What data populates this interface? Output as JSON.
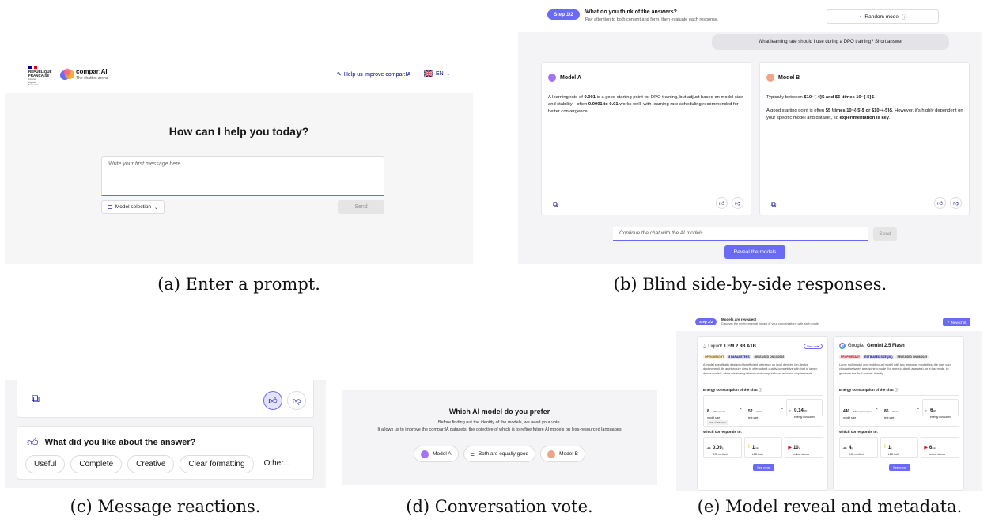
{
  "captions": {
    "a": "(a) Enter a prompt.",
    "b": "(b) Blind side-by-side responses.",
    "c": "(c) Message reactions.",
    "d": "(d) Conversation vote.",
    "e": "(e) Model reveal and metadata."
  },
  "panel_a": {
    "gov_logo_text": "RÉPUBLIQUE FRANÇAISE",
    "gov_motto": "Liberté Égalité Fraternité",
    "app_name": "compar:AI",
    "app_tagline": "The chatbot arena",
    "help_link": "Help us improve compar:IA",
    "language": "EN",
    "heading": "How can I help you today?",
    "input_placeholder": "Write your first message here",
    "model_selection_label": "Model selection",
    "send_label": "Send"
  },
  "panel_b": {
    "step_badge": "Step 1/2",
    "step_title": "What do you think of the answers?",
    "step_subtitle": "Pay attention to both content and form, then evaluate each response.",
    "mode_label": "Random mode",
    "user_question": "What learning rate should I use during a DPO training? Short answer",
    "model_a": {
      "name": "Model A",
      "text_1": "A learning rate of ",
      "text_1_bold": "0.001",
      "text_2": " is a good starting point for DPO training, but adjust based on model size and stability—often ",
      "text_2_bold": "0.0001 to 0.01",
      "text_3": " works well, with learning rate scheduling recommended for better convergence."
    },
    "model_b": {
      "name": "Model B",
      "p1_prefix": "Typically between ",
      "p1_bold": "$10~{-4}$ and $5 \\times 10~{-5}$",
      "p1_suffix": ".",
      "p2_prefix": "A good starting point is often ",
      "p2_bold": "$5 \\times 10~{-5}$ or $10~{-5}$",
      "p2_mid": ". However, it's highly dependent on your specific model and dataset, so ",
      "p2_bold2": "experimentation is key",
      "p2_suffix": "."
    },
    "continue_placeholder": "Continue the chat with the AI models",
    "send_label": "Send",
    "reveal_label": "Reveal the models"
  },
  "panel_c": {
    "question": "What did you like about the answer?",
    "tags": [
      "Useful",
      "Complete",
      "Creative",
      "Clear formatting",
      "Other..."
    ]
  },
  "panel_d": {
    "title": "Which AI model do you prefer",
    "line1": "Before finding out the identity of the models, we need your vote.",
    "line2": "It allows us to improve the compar:IA datasets, the objective of which is to refine future AI models on less-resourced languages",
    "option_a": "Model A",
    "option_equal": "Both are equally good",
    "option_b": "Model B"
  },
  "panel_e": {
    "step_badge": "Step 2/2",
    "title": "Models are revealed!",
    "subtitle": "Discover the environmental impact of your conversations with each model",
    "new_chat": "New chat",
    "left": {
      "provider": "Liquid/",
      "model": "LFM 2 8B A1B",
      "your_vote": "Your vote",
      "badges": [
        "OPEN-WEIGHT",
        "8 PARAMETERS",
        "RELEASED ON 10/2025"
      ],
      "description": "A model specifically designed for efficient inference on local devices (on-device deployment). Its architecture aims to offer output quality competitive with that of larger, dense models, while minimizing latency and computational resource requirements.",
      "energy_title": "Energy consumption of the chat",
      "params_value": "8",
      "params_unit": "billion params",
      "params_label": "model size",
      "tokens_value": "52",
      "tokens_unit": "tokens",
      "tokens_label": "text size",
      "energy_value": "0.14",
      "energy_unit": "Wh",
      "energy_label": "energy consumed",
      "arch_tag": "MoE architecture",
      "corresponds": "Which corresponds to:",
      "co2_value": "0.09",
      "co2_unit": "g",
      "co2_label": "CO₂ emitted",
      "led_value": "1",
      "led_unit": "min",
      "led_label": "LED bulb",
      "video_value": "10",
      "video_unit": "s",
      "video_label": "online videos",
      "see_more": "See more"
    },
    "right": {
      "provider": "Google/",
      "model": "Gemini 2.5 Flash",
      "badges": [
        "PROPRIETARY",
        "ESTIMATED SIZE (XL)",
        "RELEASED ON 06/2025"
      ],
      "description": "Large multimodal and multilingual model with two response modalities: the user can choose between a reasoning mode (for more in-depth answers), or a fast mode, to generate the final answer directly.",
      "energy_title": "Energy consumption of the chat",
      "params_value": "440",
      "params_unit": "billion params (est.)",
      "params_label": "model size",
      "tokens_value": "86",
      "tokens_unit": "tokens",
      "tokens_label": "text size",
      "energy_value": "6",
      "energy_unit": "Wh",
      "energy_label": "energy consumed",
      "corresponds": "Which corresponds to:",
      "co2_value": "4",
      "co2_unit": "g",
      "co2_label": "CO₂ emitted",
      "led_value": "1",
      "led_unit": "h",
      "led_label": "LED bulb",
      "video_value": "6",
      "video_unit": "min",
      "video_label": "online videos",
      "see_more": "See more"
    }
  },
  "colors": {
    "accent": "#6a6af4",
    "model_a": "#a572f2",
    "model_b": "#f0a487",
    "panel_bg": "#f4f4f7"
  }
}
